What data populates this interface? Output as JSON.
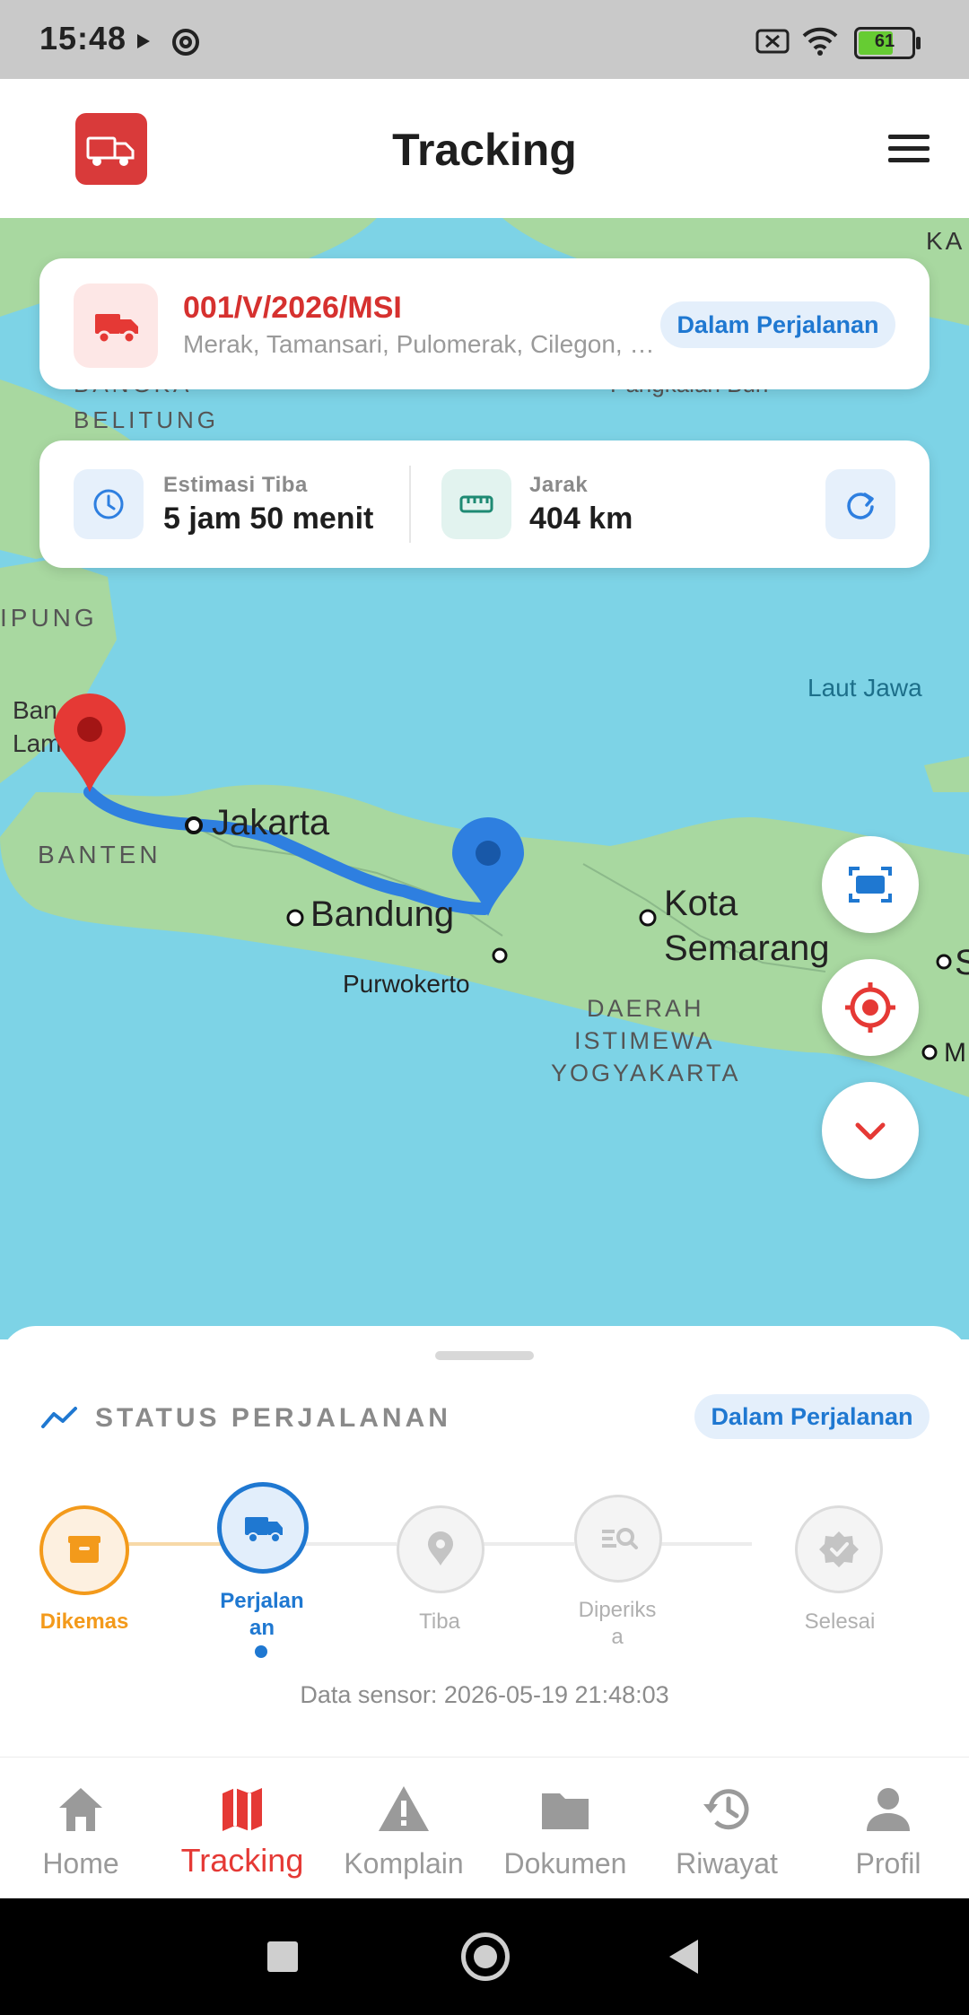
{
  "status_bar": {
    "time": "15:48",
    "battery": "61"
  },
  "header": {
    "title": "Tracking"
  },
  "map": {
    "labels": {
      "ka": "KA",
      "bangka": "BANGKA",
      "belitung": "BELITUNG",
      "pangkalan": "Pangkalan Bun",
      "lampung": "IPUNG",
      "laut_jawa": "Laut Jawa",
      "ban": "Ban",
      "lam": "Lam",
      "banten": "BANTEN",
      "jakarta": "Jakarta",
      "bandung": "Bandung",
      "kota": "Kota",
      "semarang": "Semarang",
      "purwokerto": "Purwokerto",
      "diy1": "DAERAH",
      "diy2": "ISTIMEWA",
      "diy3": "YOGYAKARTA",
      "s": "S",
      "m": "M"
    }
  },
  "order": {
    "code": "001/V/2026/MSI",
    "address": "Merak, Tamansari, Pulomerak, Cilegon, Banten",
    "status": "Dalam Perjalanan"
  },
  "eta": {
    "eta_label": "Estimasi Tiba",
    "eta_value": "5 jam 50 menit",
    "distance_label": "Jarak",
    "distance_value": "404 km"
  },
  "sheet": {
    "title": "STATUS PERJALANAN",
    "status": "Dalam Perjalanan",
    "steps": [
      {
        "label": "Dikemas"
      },
      {
        "label": "Perjalan\nan"
      },
      {
        "label": "Tiba"
      },
      {
        "label": "Diperiks\na"
      },
      {
        "label": "Selesai"
      }
    ],
    "sensor": "Data sensor: 2026-05-19 21:48:03"
  },
  "nav": {
    "home": "Home",
    "tracking": "Tracking",
    "komplain": "Komplain",
    "dokumen": "Dokumen",
    "riwayat": "Riwayat",
    "profil": "Profil"
  },
  "colors": {
    "brand_red": "#d93a3a",
    "accent_blue": "#1f78d1",
    "orange": "#f39a1b"
  }
}
